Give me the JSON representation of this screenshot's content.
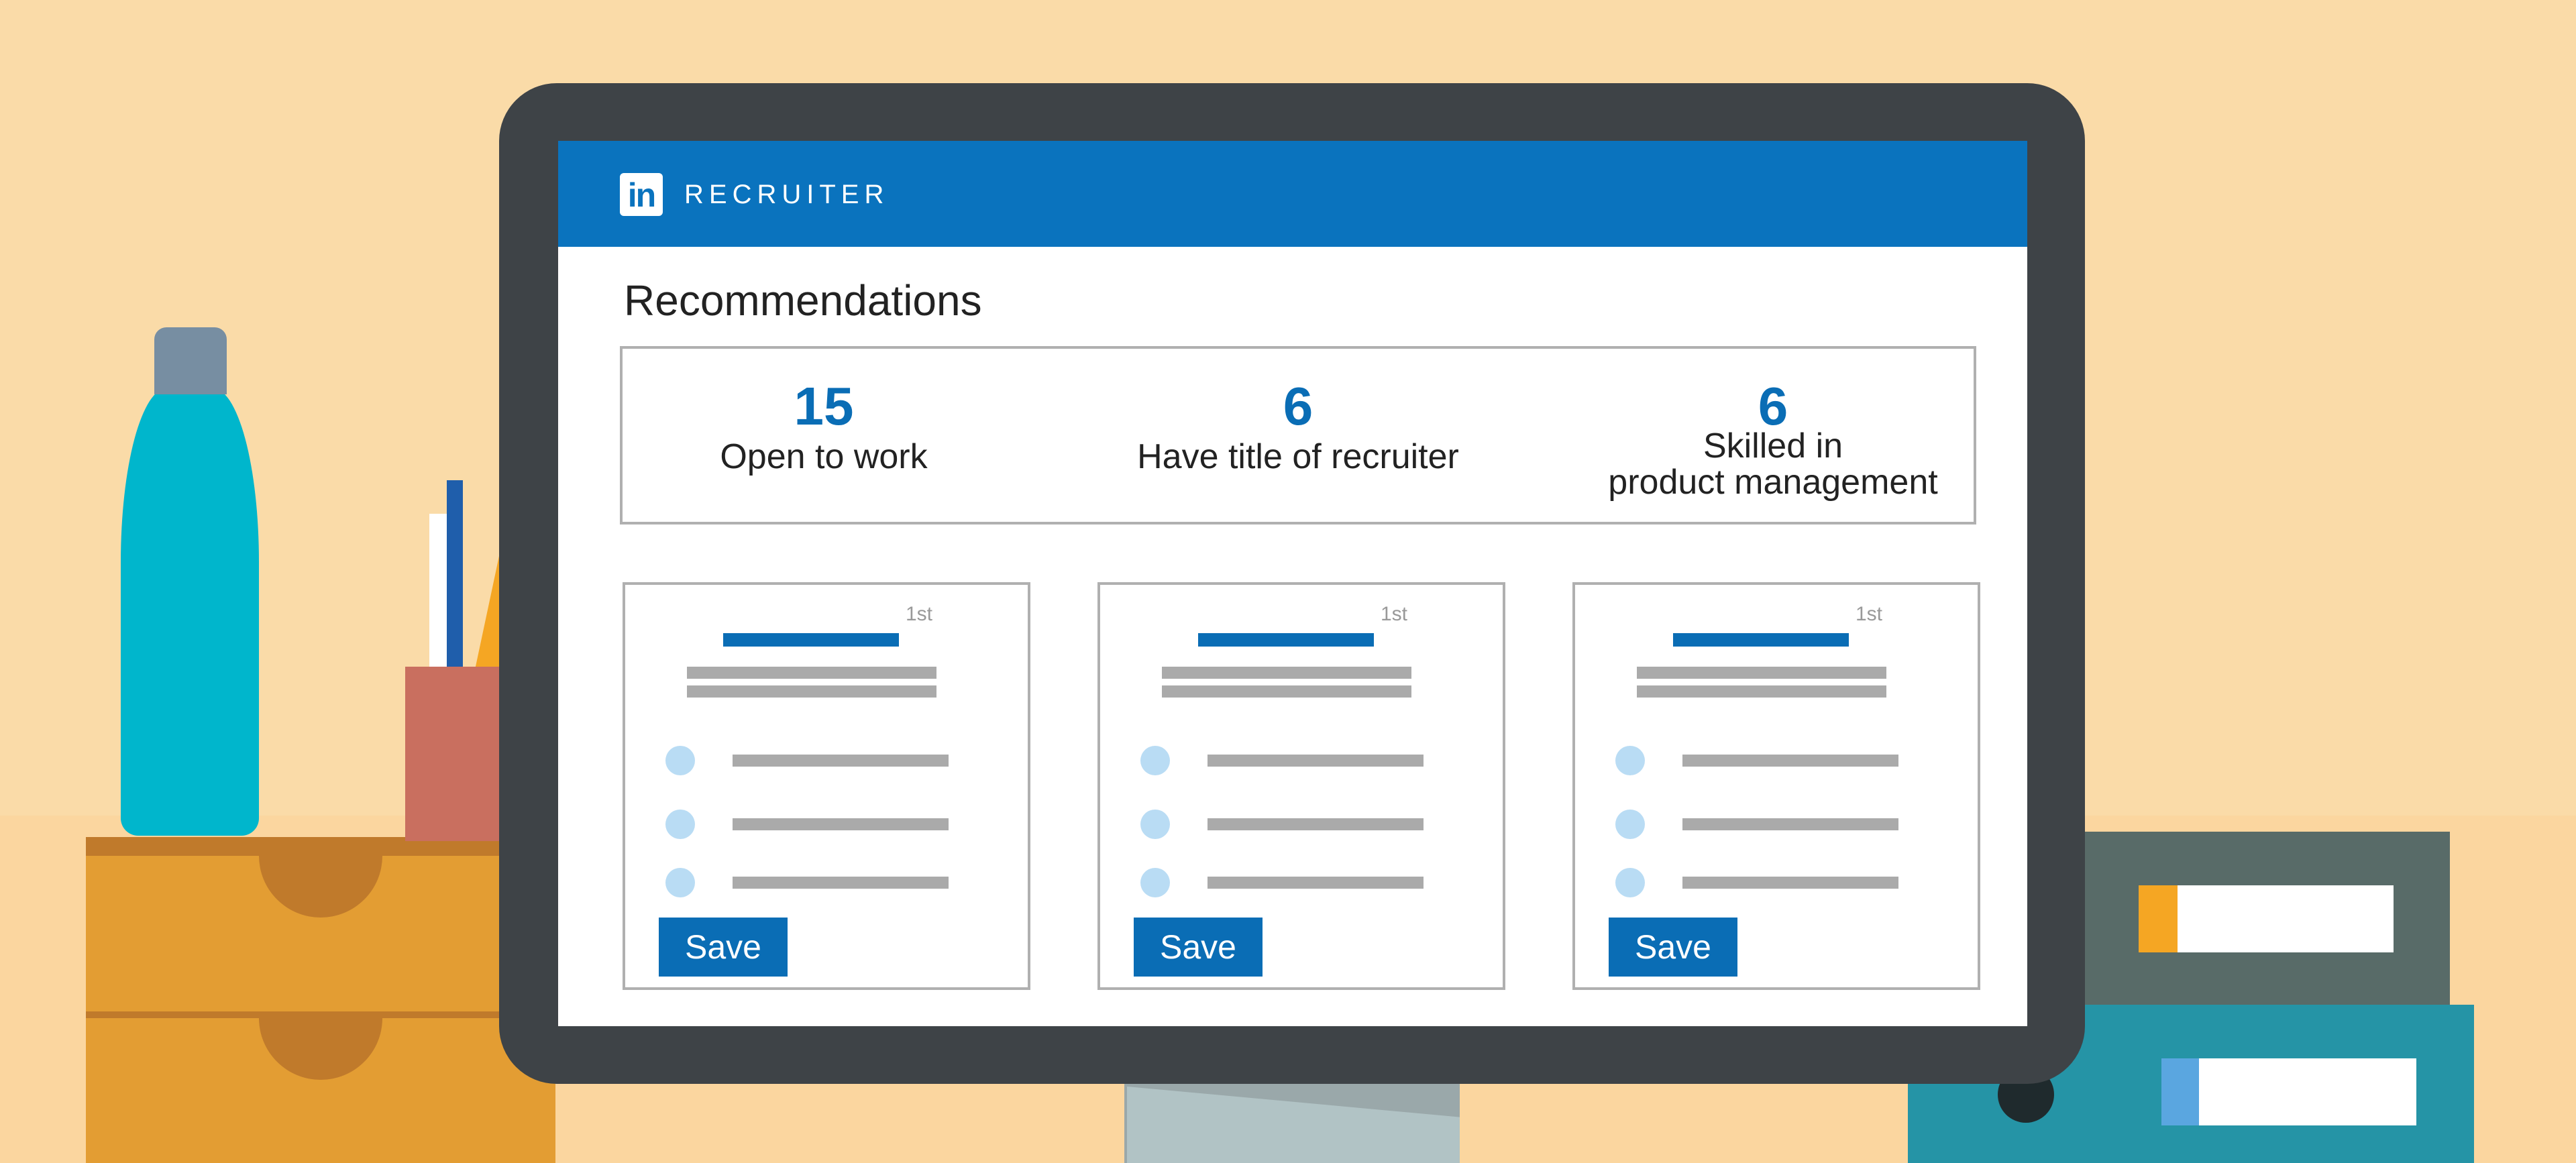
{
  "header": {
    "logo": "in",
    "product_name": "RECRUITER"
  },
  "page_title": "Recommendations",
  "stats": [
    {
      "value": "15",
      "label": "Open to work"
    },
    {
      "value": "6",
      "label": "Have title of recruiter"
    },
    {
      "value": "6",
      "label_line1": "Skilled in",
      "label_line2": "product management"
    }
  ],
  "cards": [
    {
      "degree": "1st",
      "save_label": "Save"
    },
    {
      "degree": "1st",
      "save_label": "Save"
    },
    {
      "degree": "1st",
      "save_label": "Save"
    }
  ],
  "colors": {
    "brand_blue": "#0a73be",
    "accent_blue": "#0a6db5",
    "monitor_frame": "#3e4347",
    "wall": "#fadba8"
  },
  "icons": [
    "linkedin-logo-icon"
  ]
}
